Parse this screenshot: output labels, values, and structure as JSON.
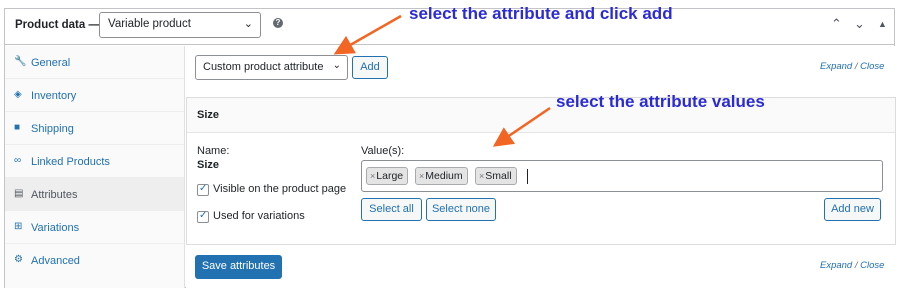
{
  "header": {
    "title": "Product data —",
    "product_type": "Variable product",
    "help": "?"
  },
  "sidebar": {
    "items": [
      {
        "label": "General",
        "icon": "wrench-icon"
      },
      {
        "label": "Inventory",
        "icon": "tag-icon"
      },
      {
        "label": "Shipping",
        "icon": "truck-icon"
      },
      {
        "label": "Linked Products",
        "icon": "link-icon"
      },
      {
        "label": "Attributes",
        "icon": "list-icon",
        "active": true
      },
      {
        "label": "Variations",
        "icon": "grid-icon"
      },
      {
        "label": "Advanced",
        "icon": "gear-icon"
      }
    ]
  },
  "toolbar": {
    "attribute_select": "Custom product attribute",
    "add_label": "Add",
    "expand": "Expand",
    "separator": "/",
    "close": "Close"
  },
  "attribute": {
    "title": "Size",
    "name_label": "Name:",
    "name_value": "Size",
    "values_label": "Value(s):",
    "values": [
      "Large",
      "Medium",
      "Small"
    ],
    "visible_label": "Visible on the product page",
    "variations_label": "Used for variations",
    "select_all": "Select all",
    "select_none": "Select none",
    "add_new": "Add new"
  },
  "footer": {
    "save_label": "Save attributes",
    "expand": "Expand",
    "separator": "/",
    "close": "Close"
  },
  "annotations": {
    "top": "select the attribute and click add",
    "middle": "select the attribute values"
  },
  "colors": {
    "accent": "#2271b1",
    "annotation_text": "#2b2bd6",
    "annotation_arrow": "#f26522"
  }
}
